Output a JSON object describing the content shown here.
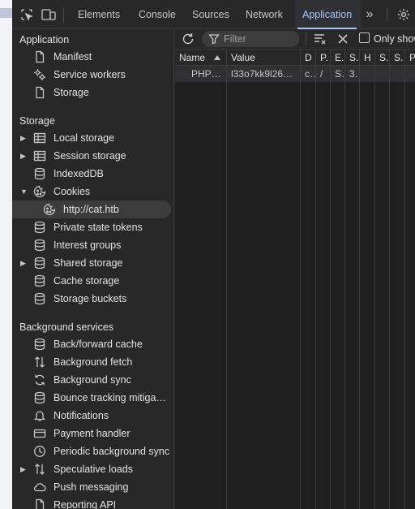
{
  "toolbar": {
    "tabs": [
      {
        "label": "Elements"
      },
      {
        "label": "Console"
      },
      {
        "label": "Sources"
      },
      {
        "label": "Network"
      },
      {
        "label": "Application"
      }
    ],
    "more_label": "»"
  },
  "sidebar": {
    "application_title": "Application",
    "application_items": [
      {
        "label": "Manifest",
        "icon": "file-icon"
      },
      {
        "label": "Service workers",
        "icon": "gears-icon"
      },
      {
        "label": "Storage",
        "icon": "file-icon"
      }
    ],
    "storage_title": "Storage",
    "storage_items": [
      {
        "label": "Local storage",
        "icon": "table-icon",
        "expandable": true
      },
      {
        "label": "Session storage",
        "icon": "table-icon",
        "expandable": true
      },
      {
        "label": "IndexedDB",
        "icon": "database-icon"
      },
      {
        "label": "Cookies",
        "icon": "cookie-icon",
        "expanded": true
      },
      {
        "label": "http://cat.htb",
        "icon": "cookie-icon",
        "selected": true
      },
      {
        "label": "Private state tokens",
        "icon": "database-icon"
      },
      {
        "label": "Interest groups",
        "icon": "database-icon"
      },
      {
        "label": "Shared storage",
        "icon": "database-icon",
        "expandable": true
      },
      {
        "label": "Cache storage",
        "icon": "database-icon"
      },
      {
        "label": "Storage buckets",
        "icon": "database-icon"
      }
    ],
    "background_title": "Background services",
    "background_items": [
      {
        "label": "Back/forward cache",
        "icon": "database-icon"
      },
      {
        "label": "Background fetch",
        "icon": "updown-arrows-icon"
      },
      {
        "label": "Background sync",
        "icon": "sync-icon"
      },
      {
        "label": "Bounce tracking mitigat…",
        "icon": "database-icon"
      },
      {
        "label": "Notifications",
        "icon": "bell-icon"
      },
      {
        "label": "Payment handler",
        "icon": "card-icon"
      },
      {
        "label": "Periodic background sync",
        "icon": "clock-icon"
      },
      {
        "label": "Speculative loads",
        "icon": "updown-arrows-icon",
        "expandable": true
      },
      {
        "label": "Push messaging",
        "icon": "cloud-icon"
      },
      {
        "label": "Reporting API",
        "icon": "file-icon"
      }
    ]
  },
  "filterbar": {
    "placeholder": "Filter",
    "only_show_label": "Only show"
  },
  "cookies_table": {
    "headers": [
      "Name",
      "Value",
      "D",
      "P.",
      "E.",
      "S.",
      "H",
      "S.",
      "S.",
      "P"
    ],
    "rows": [
      [
        "PHP…",
        "l33o7kk9l26…",
        "c…",
        "/",
        "S…",
        "3…",
        "",
        "",
        "",
        ""
      ]
    ]
  },
  "colors": {
    "accent": "#a8c7fa",
    "background": "#282828",
    "text": "#e3e3e3"
  }
}
